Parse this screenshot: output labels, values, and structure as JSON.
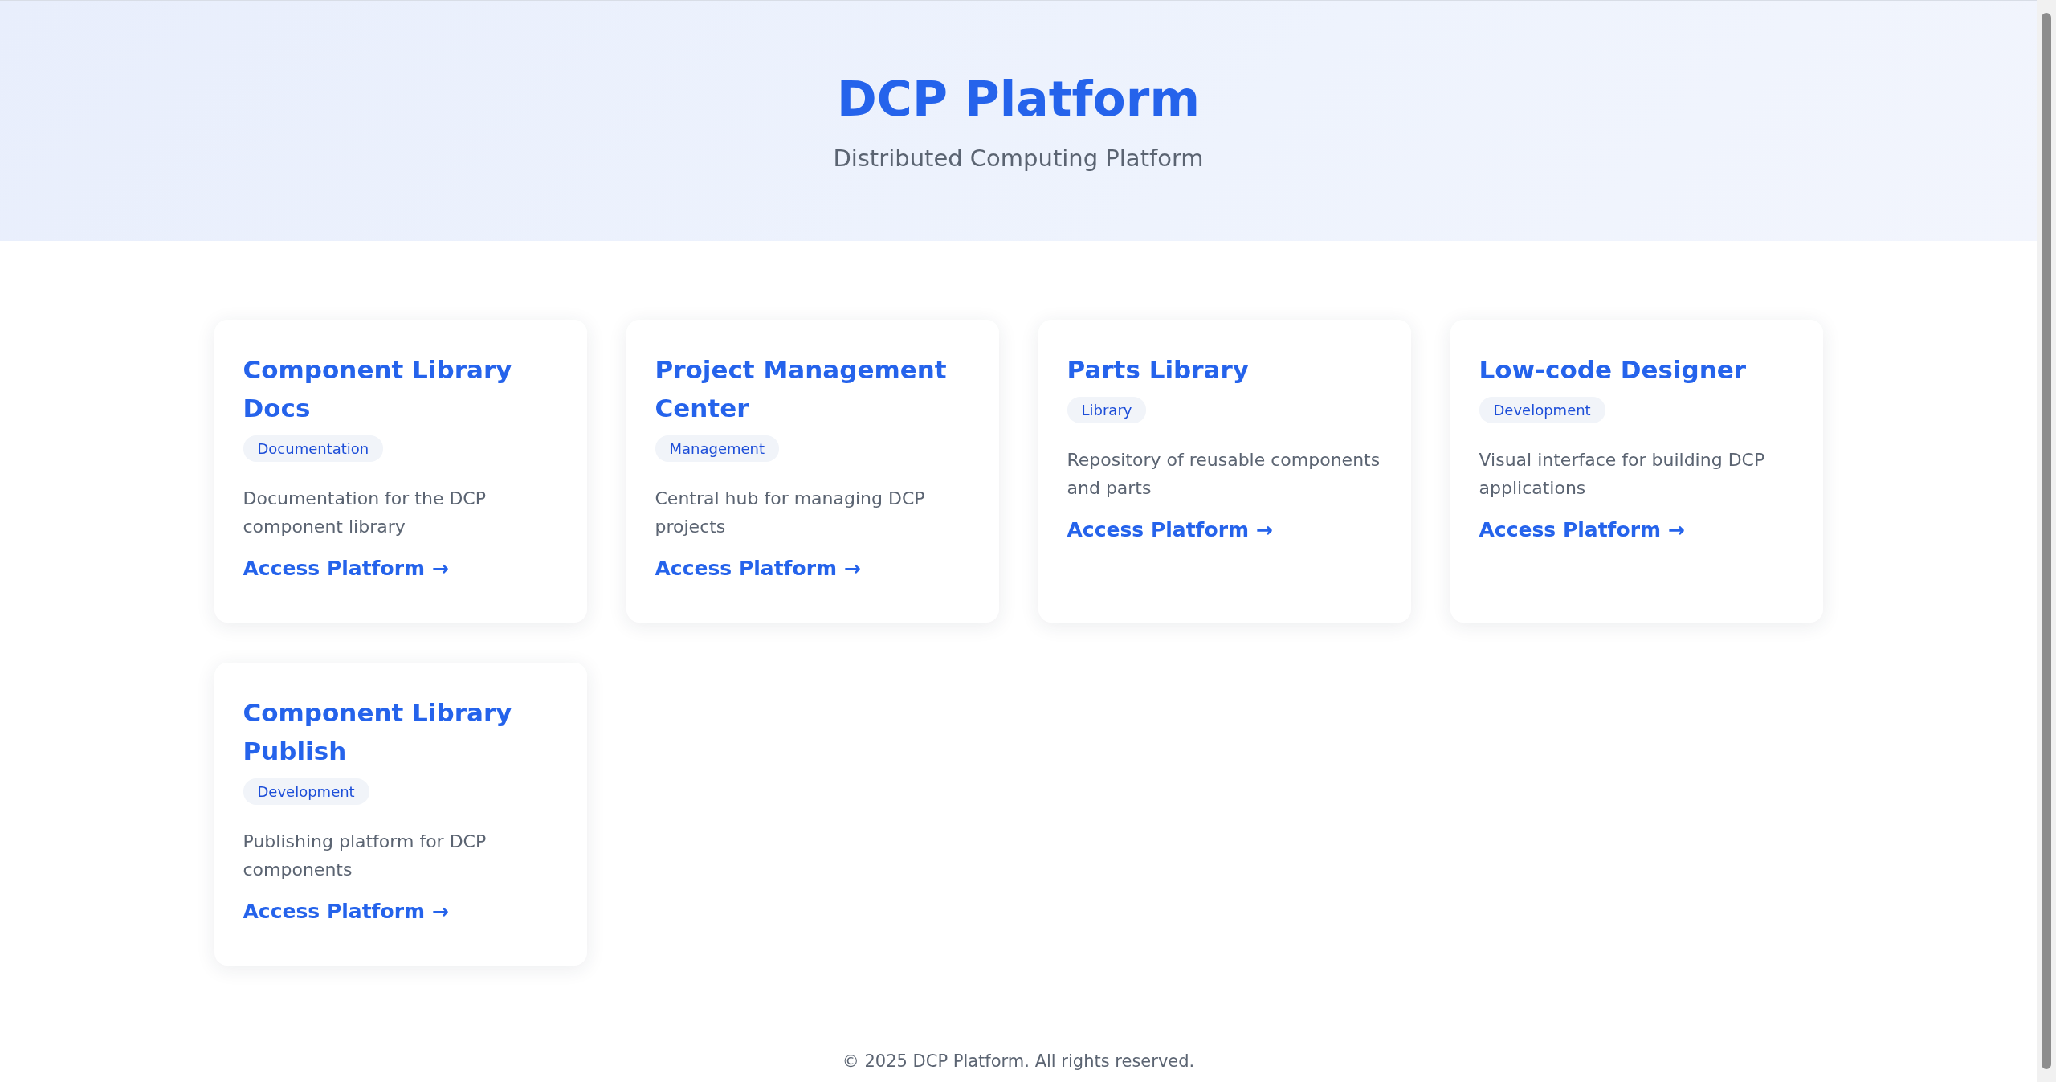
{
  "header": {
    "title": "DCP Platform",
    "subtitle": "Distributed Computing Platform"
  },
  "cards": [
    {
      "title": "Component Library Docs",
      "tag": "Documentation",
      "description": "Documentation for the DCP component library",
      "link": "Access Platform →"
    },
    {
      "title": "Project Management Center",
      "tag": "Management",
      "description": "Central hub for managing DCP projects",
      "link": "Access Platform →"
    },
    {
      "title": "Parts Library",
      "tag": "Library",
      "description": "Repository of reusable components and parts",
      "link": "Access Platform →"
    },
    {
      "title": "Low-code Designer",
      "tag": "Development",
      "description": "Visual interface for building DCP applications",
      "link": "Access Platform →"
    },
    {
      "title": "Component Library Publish",
      "tag": "Development",
      "description": "Publishing platform for DCP components",
      "link": "Access Platform →"
    }
  ],
  "footer": "© 2025 DCP Platform. All rights reserved."
}
